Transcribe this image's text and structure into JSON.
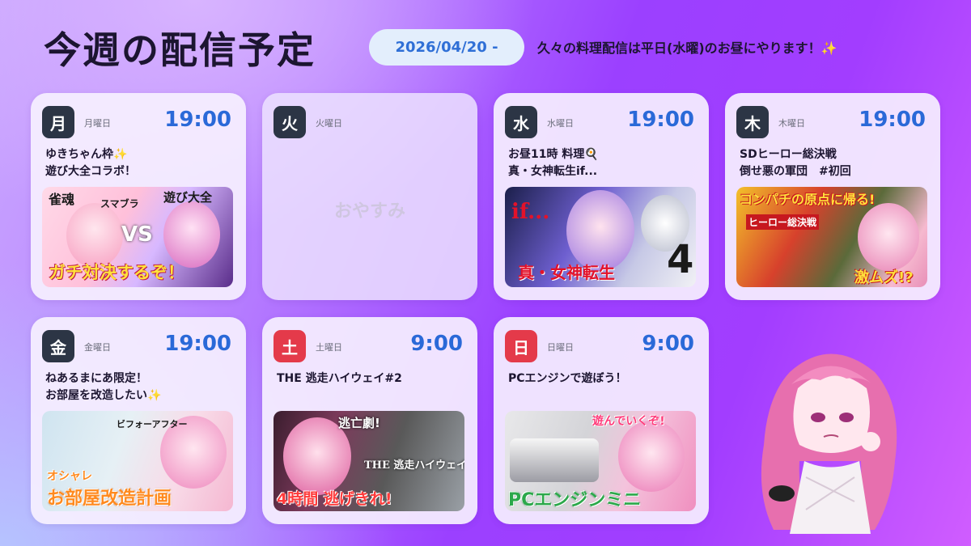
{
  "header": {
    "title": "今週の配信予定",
    "date_label": "2026/04/20 -",
    "notice": "久々の料理配信は平日(水曜)のお昼にやります！✨"
  },
  "days": [
    {
      "badge": "月",
      "name": "月曜日",
      "time": "19:00",
      "line1": "ゆきちゃん枠✨",
      "line2": "遊び大全コラボ！",
      "thumb_texts": [
        "雀魂",
        "スマブラ",
        "遊び大全",
        "VS",
        "ガチ対決するぞ！"
      ]
    },
    {
      "badge": "火",
      "name": "火曜日",
      "off_label": "おやすみ"
    },
    {
      "badge": "水",
      "name": "水曜日",
      "time": "19:00",
      "line1": "お昼11時 料理🍳",
      "line2": "真・女神転生if...",
      "thumb_texts": [
        "if...",
        "真・女神転生",
        "4"
      ]
    },
    {
      "badge": "木",
      "name": "木曜日",
      "time": "19:00",
      "line1": "SDヒーロー総決戦",
      "line2": "倒せ悪の軍団　#初回",
      "thumb_texts": [
        "コンパチの原点に帰る!",
        "ヒーロー総決戦",
        "激ムズ!?"
      ]
    },
    {
      "badge": "金",
      "name": "金曜日",
      "time": "19:00",
      "line1": "ねあるまにあ限定！",
      "line2": "お部屋を改造したい✨",
      "thumb_texts": [
        "ビフォーアフター",
        "オシャレ",
        "お部屋改造計画"
      ]
    },
    {
      "badge": "土",
      "name": "土曜日",
      "time": "9:00",
      "line1": "THE 逃走ハイウェイ#2",
      "line2": "",
      "thumb_texts": [
        "逃亡劇!",
        "THE 逃走ハイウェイ",
        "4時間 逃げきれ!"
      ]
    },
    {
      "badge": "日",
      "name": "日曜日",
      "time": "9:00",
      "line1": "PCエンジンで遊ぼう！",
      "line2": "",
      "thumb_texts": [
        "遊んでいくぞ!",
        "PCエンジンミニ"
      ]
    }
  ],
  "colors": {
    "time_blue": "#2a69d8",
    "badge_dark": "#2c3545",
    "badge_weekend": "#e43a4a",
    "pill_text": "#2f6fd6"
  }
}
